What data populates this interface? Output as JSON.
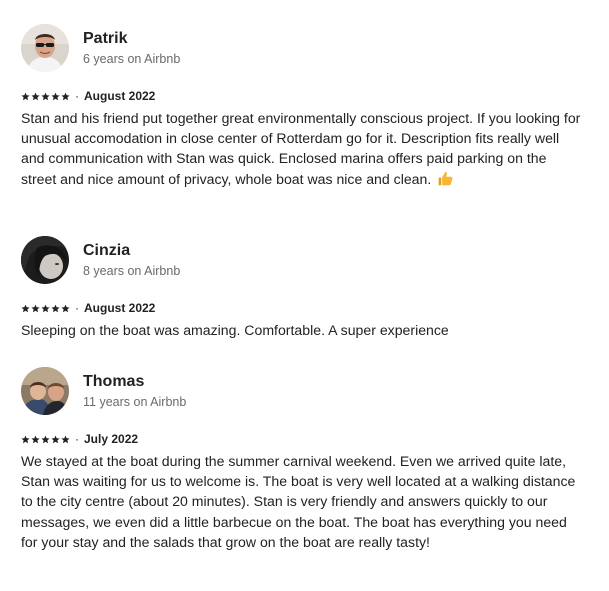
{
  "reviews": [
    {
      "name": "Patrik",
      "tenure": "6 years on Airbnb",
      "rating": 5,
      "separator": "·",
      "date": "August 2022",
      "text": "Stan and his friend put together great environmentally conscious project. If you looking for unusual accomodation in close center of Rotterdam go for it. Description fits really well and communication with Stan was quick. Enclosed marina offers paid parking on the street and nice amount of privacy, whole boat was nice and clean.",
      "emoji": "thumbs-up-icon"
    },
    {
      "name": "Cinzia",
      "tenure": "8 years on Airbnb",
      "rating": 5,
      "separator": "·",
      "date": "August 2022",
      "text": "Sleeping on the boat was amazing. Comfortable. A super experience"
    },
    {
      "name": "Thomas",
      "tenure": "11 years on Airbnb",
      "rating": 5,
      "separator": "·",
      "date": "July 2022",
      "text": "We stayed at the boat during the summer carnival weekend. Even we arrived quite late, Stan was waiting for us to welcome is. The boat is very well located at a walking distance to the city centre (about 20 minutes). Stan is very friendly and answers quickly to our messages, we even did a little barbecue on the boat. The boat has everything you need for your stay and the salads that grow on the boat are really tasty!"
    }
  ],
  "colors": {
    "text": "#222222",
    "secondary": "#6a6a6a",
    "star": "#222222",
    "thumb": "#f7b733"
  }
}
